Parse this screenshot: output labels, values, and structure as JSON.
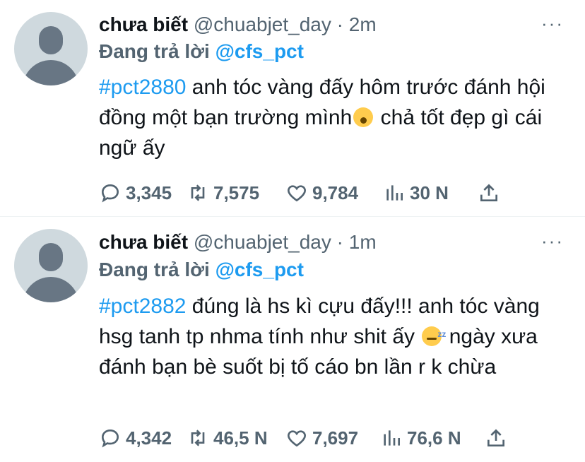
{
  "tweets": [
    {
      "name": "chưa biết",
      "handle": "@chuabjet_day",
      "dot": "·",
      "time": "2m",
      "more": "···",
      "reply_prefix": "Đang trả lời",
      "reply_mention": "@cfs_pct",
      "hashtag": "#pct2880",
      "text_a": " anh tóc vàng đấy hôm trước đánh hội đồng một bạn trường mình",
      "text_b": "  chả tốt đẹp gì cái ngữ ấy",
      "reply_count": "3,345",
      "retweet_count": "7,575",
      "like_count": "9,784",
      "views_count": "30 N"
    },
    {
      "name": "chưa biết",
      "handle": "@chuabjet_day",
      "dot": "·",
      "time": "1m",
      "more": "···",
      "reply_prefix": "Đang trả lời",
      "reply_mention": "@cfs_pct",
      "hashtag": "#pct2882",
      "text_a": " đúng là hs kì cựu đấy!!! anh tóc vàng hsg tanh tp nhma tính như shit ấy ",
      "text_b": " ngày xưa đánh bạn bè suốt bị tố cáo bn lần r k chừa",
      "reply_count": "4,342",
      "retweet_count": "46,5 N",
      "like_count": "7,697",
      "views_count": "76,6 N"
    }
  ],
  "icons": [
    "reply-icon",
    "retweet-icon",
    "like-icon",
    "views-icon",
    "share-icon",
    "yawning-face-emoji",
    "sleeping-face-emoji"
  ],
  "colors": {
    "accent": "#1d9bf0",
    "muted": "#536471",
    "text": "#0f1419"
  }
}
